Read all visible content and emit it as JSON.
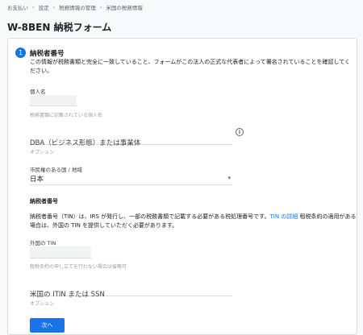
{
  "breadcrumb": [
    "お支払い",
    "設定",
    "税務情報の管理",
    "米国の税務情報"
  ],
  "page_title": "W-8BEN 納税フォーム",
  "step": {
    "number": "1",
    "title": "納税者番号",
    "description": "この情報が税務書類と完全に一致していること、フォームがこの法人の正式な代表者によって署名されていることを確認してください。"
  },
  "fields": {
    "individual_name": {
      "label": "個人名",
      "value": "",
      "helper": "税務書類に記載されている個人名"
    },
    "dba": {
      "placeholder": "DBA（ビジネス形態）または事業体",
      "helper": "オプション"
    },
    "citizenship": {
      "label": "市民権のある国 / 地域",
      "value": "日本"
    },
    "foreign_tin": {
      "label": "外国の TIN",
      "value": "",
      "helper": "租税条約の申し立てを行わない場合は省略可"
    },
    "us_tin": {
      "placeholder": "米国の ITIN または SSN",
      "helper": "オプション"
    }
  },
  "tin_section": {
    "heading": "納税者番号",
    "text_before_link": "納税者番号（TIN）は、IRS が発行し、一部の税務書類で記載する必要がある税処理番号です。",
    "link_text": "TIN の詳細",
    "text_after_link": " 租税条約の適用がある場合は、外国の TIN を提供していただく必要があります。"
  },
  "icons": {
    "info": "info-icon",
    "dropdown": "chevron-down-icon"
  },
  "next_button": "次へ",
  "colors": {
    "accent": "#1a73e8",
    "background": "#f8f9fa",
    "input_fill": "#f1f3f4"
  }
}
